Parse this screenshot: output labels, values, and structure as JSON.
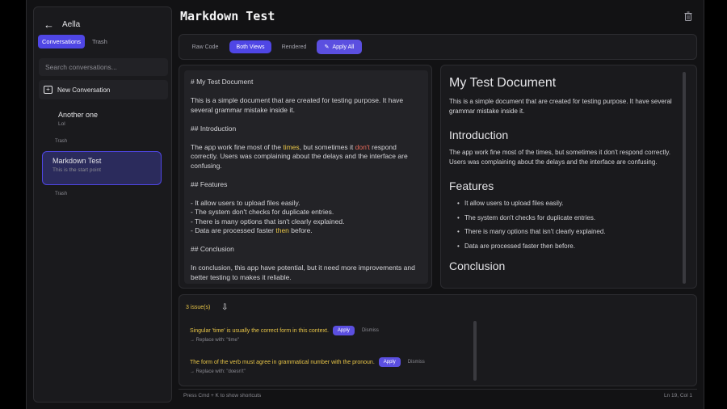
{
  "sidebar": {
    "app_name": "Aella",
    "tabs": [
      "Conversations",
      "Trash"
    ],
    "search_placeholder": "Search conversations...",
    "new_conversation": "New Conversation",
    "conversations": [
      {
        "title": "Another one",
        "subtitle": "Lol",
        "trash": "Trash"
      },
      {
        "title": "Markdown Test",
        "subtitle": "This is the start point",
        "trash": "Trash"
      }
    ]
  },
  "header": {
    "title": "Markdown Test"
  },
  "toolbar": {
    "views": [
      "Raw Code",
      "Both Views",
      "Rendered"
    ],
    "apply_all": "Apply All"
  },
  "editor": {
    "h1": "# My Test Document",
    "p1": "This is a simple document that are created for testing purpose. It have several grammar mistake inside it.",
    "h2a": "## Introduction",
    "p2_a": "The app work fine most of the ",
    "p2_time": "times",
    "p2_b": ", but sometimes it ",
    "p2_dont": "don't",
    "p2_c": " respond correctly. Users was complaining about the delays and the interface are confusing.",
    "h2b": "## Features",
    "f1": "- It allow users to upload files easily.",
    "f2": "- The system don't checks for duplicate entries.",
    "f3": "- There is many options that isn't clearly explained.",
    "f4_a": "- Data are processed faster ",
    "f4_then": "then",
    "f4_b": " before.",
    "h2c": "## Conclusion",
    "p3": "In conclusion, this app have potential, but it need more improvements and better testing to makes it reliable."
  },
  "preview": {
    "h1": "My Test Document",
    "p1": "This is a simple document that are created for testing purpose. It have several grammar mistake inside it.",
    "h2a": "Introduction",
    "p2": "The app work fine most of the times, but sometimes it don't respond correctly. Users was complaining about the delays and the interface are confusing.",
    "h2b": "Features",
    "features": [
      "It allow users to upload files easily.",
      "The system don't checks for duplicate entries.",
      "There is many options that isn't clearly explained.",
      "Data are processed faster then before."
    ],
    "h2c": "Conclusion"
  },
  "issues": {
    "count_label": "3 issue(s)",
    "items": [
      {
        "message": "Singular 'time' is usually the correct form in this context.",
        "apply": "Apply",
        "dismiss": "Dismiss",
        "replace": "→ Replace with: \"time\""
      },
      {
        "message": "The form of the verb must agree in grammatical number with the pronoun.",
        "apply": "Apply",
        "dismiss": "Dismiss",
        "replace": "→ Replace with: \"doesn't\""
      }
    ]
  },
  "status": {
    "left": "Press Cmd + K to show shortcuts",
    "right": "Ln 19, Col 1"
  },
  "colors": {
    "accent": "#4f46e5",
    "warning": "#e8c547",
    "error": "#e76a5a"
  }
}
